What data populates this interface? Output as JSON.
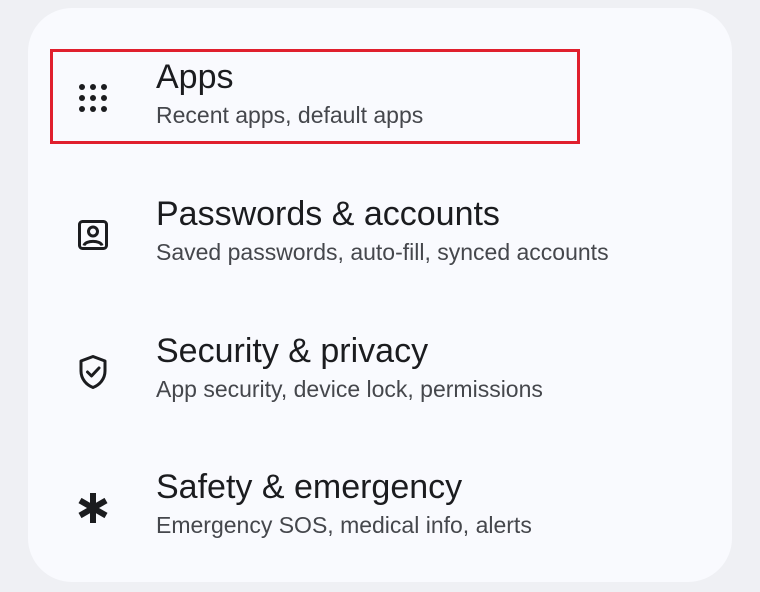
{
  "settings": {
    "items": [
      {
        "title": "Apps",
        "subtitle": "Recent apps, default apps",
        "icon": "apps-grid-icon"
      },
      {
        "title": "Passwords & accounts",
        "subtitle": "Saved passwords, auto-fill, synced accounts",
        "icon": "account-box-icon"
      },
      {
        "title": "Security & privacy",
        "subtitle": "App security, device lock, permissions",
        "icon": "shield-check-icon"
      },
      {
        "title": "Safety & emergency",
        "subtitle": "Emergency SOS, medical info, alerts",
        "icon": "asterisk-icon"
      }
    ]
  },
  "colors": {
    "background": "#eff0f4",
    "card": "#f9fafe",
    "title_text": "#1b1c1f",
    "subtitle_text": "#45474c",
    "highlight_border": "#e01f2d"
  }
}
